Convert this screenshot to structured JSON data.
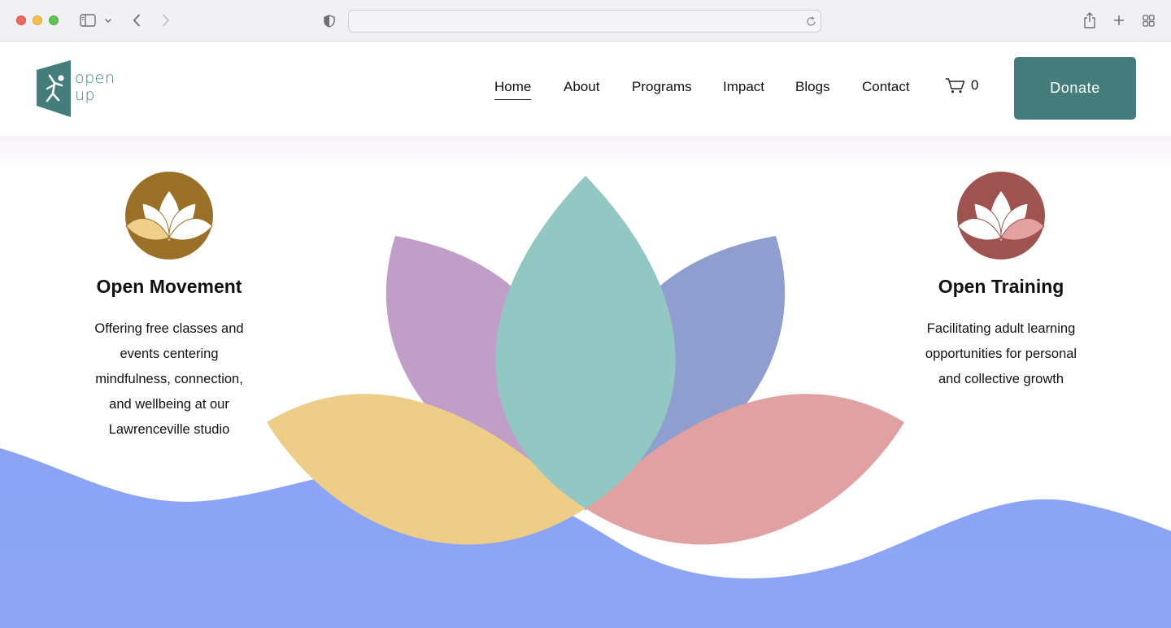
{
  "browser": {
    "address_value": "",
    "icons": [
      "sidebar-icon",
      "chevron-down-icon",
      "back-icon",
      "forward-icon",
      "shield-icon",
      "reload-icon",
      "share-icon",
      "new-tab-icon",
      "tab-overview-icon"
    ]
  },
  "header": {
    "logo": {
      "line1": "open",
      "line2": "up"
    },
    "nav": [
      {
        "label": "Home",
        "active": true
      },
      {
        "label": "About"
      },
      {
        "label": "Programs"
      },
      {
        "label": "Impact"
      },
      {
        "label": "Blogs"
      },
      {
        "label": "Contact"
      }
    ],
    "cart_count": "0",
    "donate_label": "Donate"
  },
  "programs": [
    {
      "title": "Open Movement",
      "description": [
        "Offering free classes and",
        "events centering",
        "mindfulness, connection,",
        "and wellbeing at our",
        "Lawrenceville studio"
      ],
      "icon_color": "#9a7028"
    },
    {
      "title": "Open Training",
      "description": [
        "Facilitating adult learning",
        "opportunities for personal",
        "and collective growth"
      ],
      "icon_color": "#9e5350"
    }
  ],
  "colors": {
    "brand_teal": "#447d7c",
    "petal_teal": "#93c7c4",
    "petal_purple": "#c19ec7",
    "petal_blue": "#8f9ece",
    "petal_yellow": "#edcd87",
    "petal_pink": "#e1a1a2",
    "wave_blue": "#8aa3f5"
  }
}
